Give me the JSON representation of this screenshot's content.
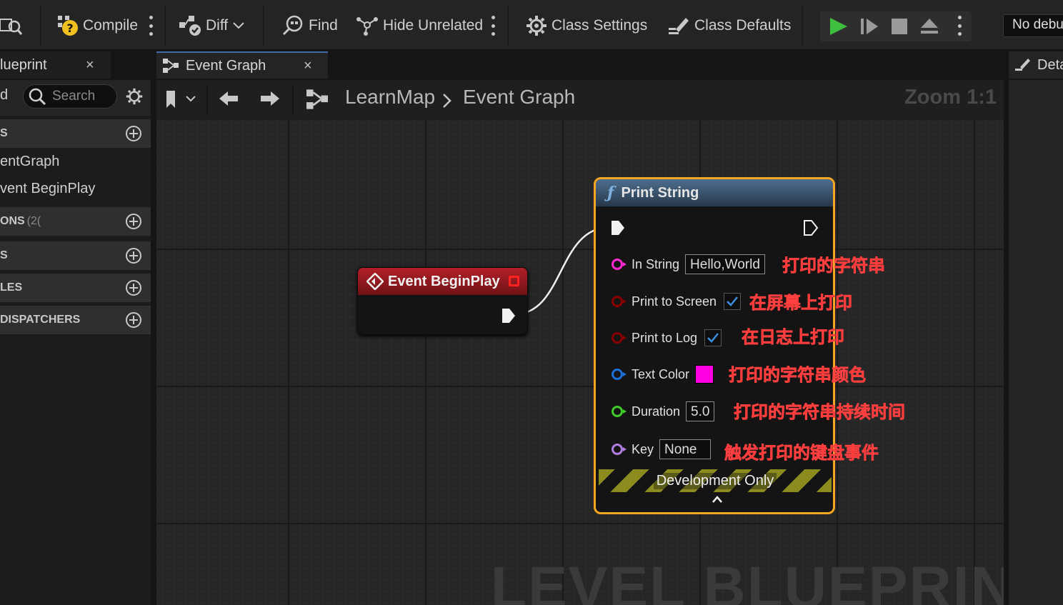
{
  "toolbar": {
    "compile": "Compile",
    "diff": "Diff",
    "find": "Find",
    "hide_unrelated": "Hide Unrelated",
    "class_settings": "Class Settings",
    "class_defaults": "Class Defaults",
    "debug_select": "No debu"
  },
  "tabs": {
    "left": "lueprint",
    "event_graph": "Event Graph",
    "details": "Deta"
  },
  "left_panel": {
    "search_placeholder": "Search",
    "partial_label": "d",
    "sections": [
      {
        "label": "S"
      },
      {
        "label": "ONS",
        "count": "(2("
      },
      {
        "label": "S"
      },
      {
        "label": "LES"
      },
      {
        "label": "DISPATCHERS"
      }
    ],
    "items": [
      "entGraph",
      "vent BeginPlay"
    ]
  },
  "breadcrumb": {
    "map": "LearnMap",
    "graph": "Event Graph",
    "zoom": "Zoom 1:1"
  },
  "watermark": "LEVEL BLUEPRINT",
  "nodes": {
    "begin_play": {
      "title": "Event BeginPlay"
    },
    "print_string": {
      "title": "Print String",
      "pins": {
        "in_string": {
          "label": "In String",
          "value": "Hello,World"
        },
        "print_to_screen": {
          "label": "Print to Screen"
        },
        "print_to_log": {
          "label": "Print to Log"
        },
        "text_color": {
          "label": "Text Color",
          "color": "#ff00e0"
        },
        "duration": {
          "label": "Duration",
          "value": "5.0"
        },
        "key": {
          "label": "Key",
          "value": "None"
        }
      },
      "dev_only": "Development Only"
    }
  },
  "annotations": {
    "in_string": "打印的字符串",
    "print_to_screen": "在屏幕上打印",
    "print_to_log": "在日志上打印",
    "text_color": "打印的字符串颜色",
    "duration": "打印的字符串持续时间",
    "key": "触发打印的键盘事件"
  },
  "colors": {
    "accent_orange": "#f5a623",
    "event_red": "#b21f27",
    "annotation_red": "#ff2a2a",
    "play_green": "#3fbf3f"
  }
}
